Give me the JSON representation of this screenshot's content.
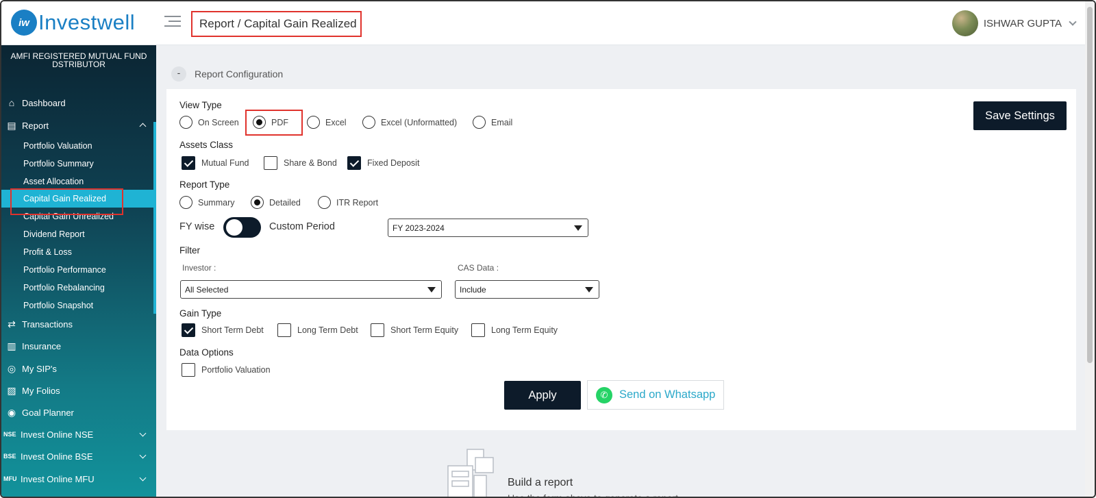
{
  "header": {
    "logo_mark": "iw",
    "logo_text": "Investwell",
    "breadcrumb": "Report / Capital Gain Realized",
    "user_name": "ISHWAR GUPTA"
  },
  "sidebar": {
    "title": "AMFI REGISTERED MUTUAL FUND DSTRIBUTOR",
    "items": {
      "dashboard": "Dashboard",
      "report": "Report",
      "transactions": "Transactions",
      "insurance": "Insurance",
      "my_sips": "My SIP's",
      "my_folios": "My Folios",
      "goal_planner": "Goal Planner",
      "invest_nse": "Invest Online NSE",
      "invest_bse": "Invest Online BSE",
      "invest_mfu": "Invest Online MFU"
    },
    "tags": {
      "nse": "NSE",
      "bse": "BSE",
      "mfu": "MFU"
    },
    "report_sub": [
      "Portfolio Valuation",
      "Portfolio Summary",
      "Asset Allocation",
      "Capital Gain Realized",
      "Capital Gain Unrealized",
      "Dividend Report",
      "Profit & Loss",
      "Portfolio Performance",
      "Portfolio Rebalancing",
      "Portfolio Snapshot"
    ],
    "active_sub": "Capital Gain Realized"
  },
  "config": {
    "collapse_symbol": "-",
    "section_label": "Report Configuration",
    "save_label": "Save Settings",
    "view_type": {
      "label": "View Type",
      "options": [
        "On Screen",
        "PDF",
        "Excel",
        "Excel (Unformatted)",
        "Email"
      ],
      "selected": "PDF"
    },
    "assets_class": {
      "label": "Assets Class",
      "options": [
        "Mutual Fund",
        "Share & Bond",
        "Fixed Deposit"
      ],
      "checked": [
        "Mutual Fund",
        "Fixed Deposit"
      ]
    },
    "report_type": {
      "label": "Report Type",
      "options": [
        "Summary",
        "Detailed",
        "ITR Report"
      ],
      "selected": "Detailed"
    },
    "period": {
      "fy_label": "FY wise",
      "custom_label": "Custom Period",
      "fy_value": "FY 2023-2024"
    },
    "filter": {
      "label": "Filter",
      "investor_label": "Investor :",
      "investor_value": "All Selected",
      "cas_label": "CAS Data :",
      "cas_value": "Include"
    },
    "gain_type": {
      "label": "Gain Type",
      "options": [
        "Short Term Debt",
        "Long Term Debt",
        "Short Term Equity",
        "Long Term Equity"
      ],
      "checked": [
        "Short Term Debt"
      ]
    },
    "data_options": {
      "label": "Data Options",
      "options": [
        "Portfolio Valuation"
      ],
      "checked": []
    },
    "apply_label": "Apply",
    "whatsapp_label": "Send on Whatsapp"
  },
  "empty_state": {
    "title": "Build a report",
    "subtitle": "Use the form above to generate a report"
  },
  "colors": {
    "accent": "#1fb3d4",
    "dark_button": "#0d1b2a",
    "highlight": "#e0322c",
    "whatsapp": "#25d366"
  }
}
